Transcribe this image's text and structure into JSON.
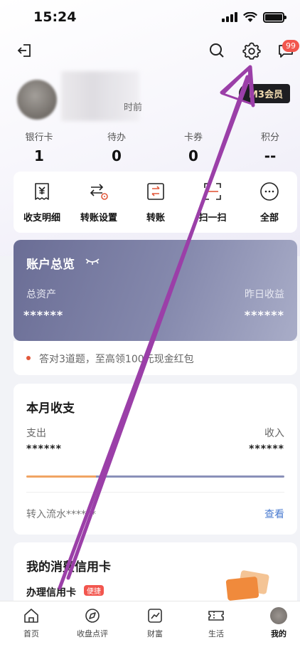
{
  "status_bar": {
    "time": "15:24"
  },
  "header": {
    "message_badge": "99"
  },
  "profile": {
    "login_time": "时前",
    "member_label": "M3会员"
  },
  "stats": [
    {
      "label": "银行卡",
      "value": "1"
    },
    {
      "label": "待办",
      "value": "0"
    },
    {
      "label": "卡券",
      "value": "0"
    },
    {
      "label": "积分",
      "value": "--"
    }
  ],
  "quick_actions": [
    {
      "label": "收支明细",
      "icon": "receipt-icon"
    },
    {
      "label": "转账设置",
      "icon": "transfer-settings-icon"
    },
    {
      "label": "转账",
      "icon": "transfer-icon"
    },
    {
      "label": "扫一扫",
      "icon": "scan-icon"
    },
    {
      "label": "全部",
      "icon": "more-icon"
    }
  ],
  "overview": {
    "title": "账户总览",
    "total_assets_label": "总资产",
    "total_assets_value": "******",
    "yesterday_label": "昨日收益",
    "yesterday_value": "******"
  },
  "promo": {
    "text": "答对3道题，至高领100元现金红包"
  },
  "monthly": {
    "title": "本月收支",
    "expense_label": "支出",
    "expense_value": "******",
    "income_label": "收入",
    "income_value": "******",
    "expense_share": 0.27,
    "flow_text": "转入流水******",
    "view_label": "查看"
  },
  "credit": {
    "title": "我的消费信用卡",
    "apply_label": "办理信用卡",
    "apply_tag": "便捷"
  },
  "tabbar": [
    {
      "label": "首页",
      "icon": "home-icon"
    },
    {
      "label": "收盘点评",
      "icon": "compass-icon"
    },
    {
      "label": "财富",
      "icon": "chart-icon"
    },
    {
      "label": "生活",
      "icon": "ticket-icon"
    },
    {
      "label": "我的",
      "icon": "avatar"
    }
  ],
  "colors": {
    "accent_purple": "#9b3fa8",
    "badge_red": "#f2564e",
    "link_blue": "#4a7bd0",
    "expense_orange": "#f0a463"
  }
}
